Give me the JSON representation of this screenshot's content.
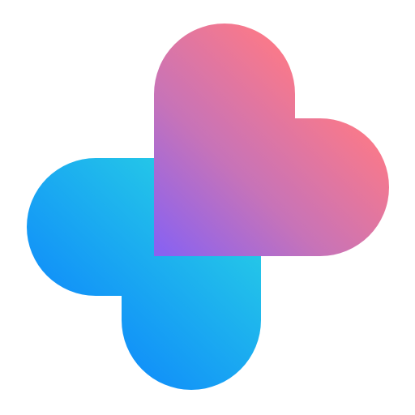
{
  "logo": {
    "icon": "two-hearts-cross-logo",
    "blue_heart": {
      "icon": "blue-heart-icon",
      "colors": [
        "#0a7cff",
        "#2ad6e3"
      ]
    },
    "pink_heart": {
      "icon": "pink-heart-icon",
      "colors": [
        "#8a62f0",
        "#c773b8",
        "#ff7a85"
      ]
    },
    "background": "#ffffff"
  }
}
